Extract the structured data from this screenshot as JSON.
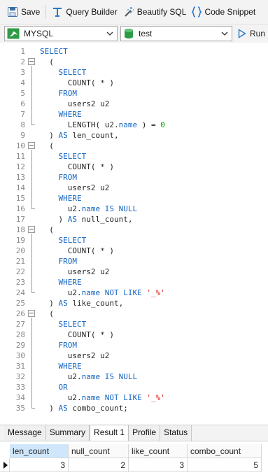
{
  "toolbar": {
    "save_label": "Save",
    "query_builder_label": "Query Builder",
    "beautify_label": "Beautify SQL",
    "code_snippet_label": "Code Snippet"
  },
  "connection": {
    "selected": "MYSQL",
    "database": "test",
    "run_label": "Run"
  },
  "editor": {
    "lines": [
      [
        {
          "t": "SELECT",
          "c": "kw"
        }
      ],
      [
        {
          "t": "  ("
        }
      ],
      [
        {
          "t": "    "
        },
        {
          "t": "SELECT",
          "c": "kw"
        }
      ],
      [
        {
          "t": "      COUNT( * )"
        }
      ],
      [
        {
          "t": "    "
        },
        {
          "t": "FROM",
          "c": "kw"
        }
      ],
      [
        {
          "t": "      users2 u2"
        }
      ],
      [
        {
          "t": "    "
        },
        {
          "t": "WHERE",
          "c": "kw"
        }
      ],
      [
        {
          "t": "      LENGTH( u2."
        },
        {
          "t": "name",
          "c": "kw"
        },
        {
          "t": " ) = "
        },
        {
          "t": "0",
          "c": "num"
        }
      ],
      [
        {
          "t": "  ) "
        },
        {
          "t": "AS",
          "c": "kw"
        },
        {
          "t": " len_count,"
        }
      ],
      [
        {
          "t": "  ("
        }
      ],
      [
        {
          "t": "    "
        },
        {
          "t": "SELECT",
          "c": "kw"
        }
      ],
      [
        {
          "t": "      COUNT( * )"
        }
      ],
      [
        {
          "t": "    "
        },
        {
          "t": "FROM",
          "c": "kw"
        }
      ],
      [
        {
          "t": "      users2 u2"
        }
      ],
      [
        {
          "t": "    "
        },
        {
          "t": "WHERE",
          "c": "kw"
        }
      ],
      [
        {
          "t": "      u2."
        },
        {
          "t": "name",
          "c": "kw"
        },
        {
          "t": " "
        },
        {
          "t": "IS NULL",
          "c": "kw"
        }
      ],
      [
        {
          "t": "    ) "
        },
        {
          "t": "AS",
          "c": "kw"
        },
        {
          "t": " null_count,"
        }
      ],
      [
        {
          "t": "  ("
        }
      ],
      [
        {
          "t": "    "
        },
        {
          "t": "SELECT",
          "c": "kw"
        }
      ],
      [
        {
          "t": "      COUNT( * )"
        }
      ],
      [
        {
          "t": "    "
        },
        {
          "t": "FROM",
          "c": "kw"
        }
      ],
      [
        {
          "t": "      users2 u2"
        }
      ],
      [
        {
          "t": "    "
        },
        {
          "t": "WHERE",
          "c": "kw"
        }
      ],
      [
        {
          "t": "      u2."
        },
        {
          "t": "name",
          "c": "kw"
        },
        {
          "t": " "
        },
        {
          "t": "NOT LIKE",
          "c": "kw"
        },
        {
          "t": " "
        },
        {
          "t": "'_%'",
          "c": "str"
        }
      ],
      [
        {
          "t": "  ) "
        },
        {
          "t": "AS",
          "c": "kw"
        },
        {
          "t": " like_count,"
        }
      ],
      [
        {
          "t": "  ("
        }
      ],
      [
        {
          "t": "    "
        },
        {
          "t": "SELECT",
          "c": "kw"
        }
      ],
      [
        {
          "t": "      COUNT( * )"
        }
      ],
      [
        {
          "t": "    "
        },
        {
          "t": "FROM",
          "c": "kw"
        }
      ],
      [
        {
          "t": "      users2 u2"
        }
      ],
      [
        {
          "t": "    "
        },
        {
          "t": "WHERE",
          "c": "kw"
        }
      ],
      [
        {
          "t": "      u2."
        },
        {
          "t": "name",
          "c": "kw"
        },
        {
          "t": " "
        },
        {
          "t": "IS NULL",
          "c": "kw"
        }
      ],
      [
        {
          "t": "    "
        },
        {
          "t": "OR",
          "c": "kw"
        }
      ],
      [
        {
          "t": "      u2."
        },
        {
          "t": "name",
          "c": "kw"
        },
        {
          "t": " "
        },
        {
          "t": "NOT LIKE",
          "c": "kw"
        },
        {
          "t": " "
        },
        {
          "t": "'_%'",
          "c": "str"
        }
      ],
      [
        {
          "t": "  ) "
        },
        {
          "t": "AS",
          "c": "kw"
        },
        {
          "t": " combo_count;"
        }
      ]
    ],
    "fold_lines": [
      2,
      10,
      18,
      26
    ]
  },
  "result_tabs": [
    "Message",
    "Summary",
    "Result 1",
    "Profile",
    "Status"
  ],
  "active_tab": "Result 1",
  "result_grid": {
    "columns": [
      "len_count",
      "null_count",
      "like_count",
      "combo_count"
    ],
    "rows": [
      [
        "3",
        "2",
        "3",
        "5"
      ]
    ]
  },
  "colors": {
    "keyword": "#1565c0",
    "number": "#00a000",
    "string": "#d81b1b",
    "selected_header": "#cfe6fb"
  }
}
